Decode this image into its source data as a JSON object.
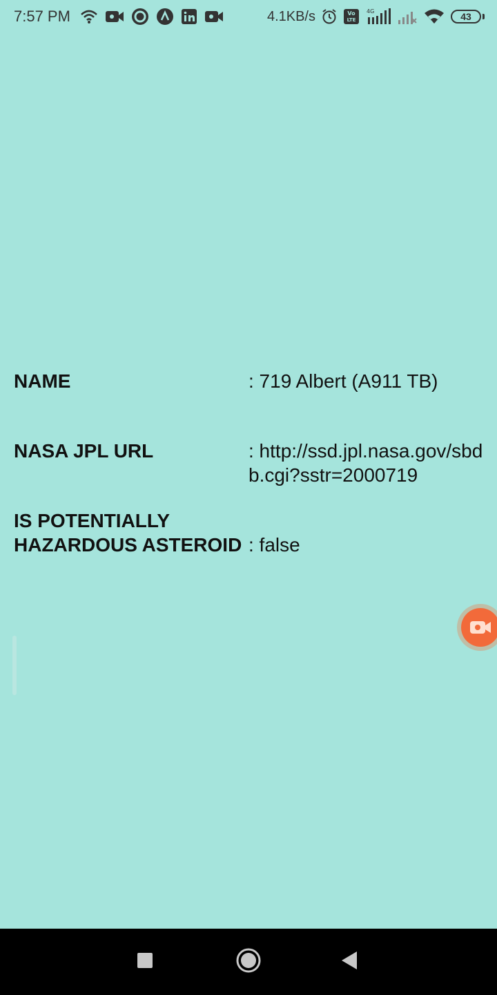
{
  "status_bar": {
    "time": "7:57 PM",
    "net_speed": "4.1KB/s",
    "battery_level": "43",
    "left_icons": [
      "wifi-hotspot-icon",
      "video-camera-icon",
      "circle-app-icon",
      "arrow-app-icon",
      "linkedin-icon",
      "video-camera-icon"
    ],
    "right_icons": [
      "alarm-icon",
      "volte-icon",
      "signal-4g-icon",
      "signal-icon",
      "wifi-icon",
      "battery-icon"
    ]
  },
  "asteroid": {
    "name_label": "NAME",
    "name_value": ": 719 Albert (A911 TB)",
    "url_label": "NASA JPL URL",
    "url_value": ": http://ssd.jpl.nasa.gov/sbdb.cgi?sstr=2000719",
    "hazard_label": "IS POTENTIALLY HAZARDOUS ASTEROID",
    "hazard_value": ": false"
  },
  "floating_button": {
    "icon": "screen-recorder-icon"
  },
  "nav_bar": {
    "buttons": [
      "recents-icon",
      "home-icon",
      "back-icon"
    ]
  },
  "colors": {
    "background": "#a5e4dc",
    "nav_background": "#000000",
    "recorder": "#f26a3a"
  }
}
